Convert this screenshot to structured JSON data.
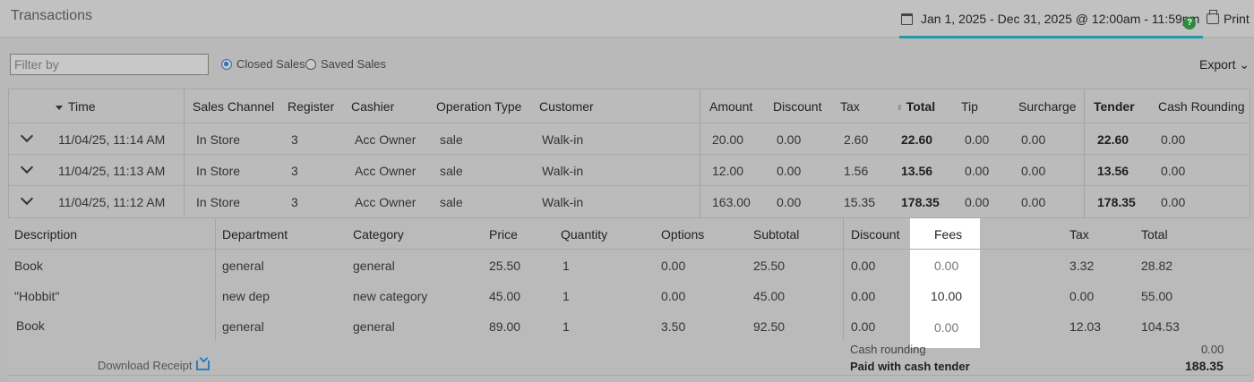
{
  "header": {
    "title": "Transactions",
    "date_range": "Jan 1, 2025 - Dec 31, 2025 @ 12:00am - 11:59pm",
    "help": "?",
    "print_label": "Print"
  },
  "toolbar": {
    "filter_placeholder": "Filter by",
    "radio_closed": "Closed Sales",
    "radio_saved": "Saved Sales",
    "export_label": "Export ⌄"
  },
  "grid": {
    "columns": {
      "time": "Time",
      "sales_channel": "Sales Channel",
      "register": "Register",
      "cashier": "Cashier",
      "operation_type": "Operation Type",
      "customer": "Customer",
      "amount": "Amount",
      "discount": "Discount",
      "tax": "Tax",
      "total": "Total",
      "tip": "Tip",
      "surcharge": "Surcharge",
      "tender": "Tender",
      "cash_rounding": "Cash Rounding"
    },
    "rows": [
      {
        "time": "11/04/25, 11:14 AM",
        "channel": "In Store",
        "register": "3",
        "cashier": "Acc Owner",
        "op": "sale",
        "customer": "Walk-in",
        "amount": "20.00",
        "discount": "0.00",
        "tax": "2.60",
        "total": "22.60",
        "tip": "0.00",
        "surcharge": "0.00",
        "tender": "22.60",
        "rounding": "0.00"
      },
      {
        "time": "11/04/25, 11:13 AM",
        "channel": "In Store",
        "register": "3",
        "cashier": "Acc Owner",
        "op": "sale",
        "customer": "Walk-in",
        "amount": "12.00",
        "discount": "0.00",
        "tax": "1.56",
        "total": "13.56",
        "tip": "0.00",
        "surcharge": "0.00",
        "tender": "13.56",
        "rounding": "0.00"
      },
      {
        "time": "11/04/25, 11:12 AM",
        "channel": "In Store",
        "register": "3",
        "cashier": "Acc Owner",
        "op": "sale",
        "customer": "Walk-in",
        "amount": "163.00",
        "discount": "0.00",
        "tax": "15.35",
        "total": "178.35",
        "tip": "0.00",
        "surcharge": "0.00",
        "tender": "178.35",
        "rounding": "0.00"
      }
    ]
  },
  "detail": {
    "columns": {
      "description": "Description",
      "department": "Department",
      "category": "Category",
      "price": "Price",
      "quantity": "Quantity",
      "options": "Options",
      "subtotal": "Subtotal",
      "discount": "Discount",
      "fees": "Fees",
      "tax": "Tax",
      "total": "Total"
    },
    "items": [
      {
        "description": "Book",
        "department": "general",
        "category": "general",
        "price": "25.50",
        "quantity": "1",
        "options": "0.00",
        "subtotal": "25.50",
        "discount": "0.00",
        "fees": "0.00",
        "tax": "3.32",
        "total": "28.82"
      },
      {
        "description": "\"Hobbit\"",
        "department": "new dep",
        "category": "new category",
        "price": "45.00",
        "quantity": "1",
        "options": "0.00",
        "subtotal": "45.00",
        "discount": "0.00",
        "fees": "10.00",
        "tax": "0.00",
        "total": "55.00"
      },
      {
        "description": "Book",
        "department": "general",
        "category": "general",
        "price": "89.00",
        "quantity": "1",
        "options": "3.50",
        "subtotal": "92.50",
        "discount": "0.00",
        "fees": "0.00",
        "tax": "12.03",
        "total": "104.53"
      }
    ],
    "cash_rounding_label": "Cash rounding",
    "cash_rounding_value": "0.00",
    "paid_label": "Paid with cash tender",
    "paid_value": "188.35",
    "download_label": "Download Receipt"
  }
}
